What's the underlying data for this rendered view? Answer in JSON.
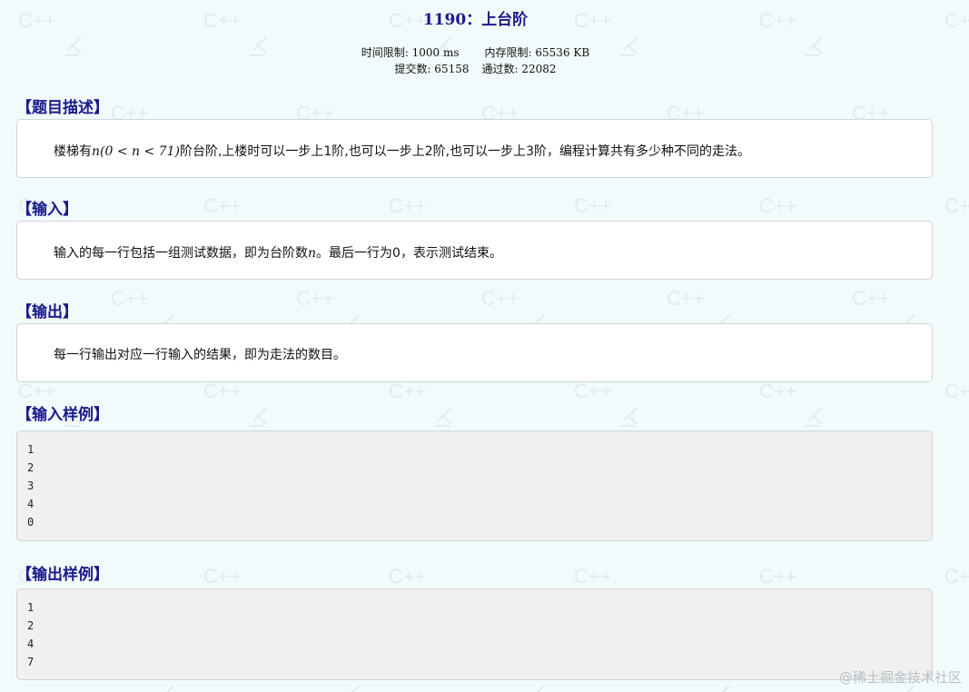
{
  "problem": {
    "title": "1190：上台阶",
    "time_limit": "时间限制: 1000 ms",
    "memory_limit": "内存限制: 65536 KB",
    "submissions": "提交数: 65158",
    "accepted": "通过数: 22082"
  },
  "sections": {
    "description": {
      "heading": "【题目描述】",
      "text_prefix": "楼梯有",
      "math": "n(0 < n < 71)",
      "text_suffix": "阶台阶,上楼时可以一步上1阶,也可以一步上2阶,也可以一步上3阶，编程计算共有多少种不同的走法。"
    },
    "input": {
      "heading": "【输入】",
      "text_prefix": "输入的每一行包括一组测试数据，即为台阶数",
      "math": "n",
      "text_suffix": "。最后一行为0，表示测试结束。"
    },
    "output": {
      "heading": "【输出】",
      "text": "每一行输出对应一行输入的结果，即为走法的数目。"
    },
    "sample_input": {
      "heading": "【输入样例】",
      "lines": [
        "1",
        "2",
        "3",
        "4",
        "0"
      ]
    },
    "sample_output": {
      "heading": "【输出样例】",
      "lines": [
        "1",
        "2",
        "4",
        "7"
      ]
    }
  },
  "watermark": {
    "footer": "@稀土掘金技术社区",
    "pattern_text": "C++"
  }
}
